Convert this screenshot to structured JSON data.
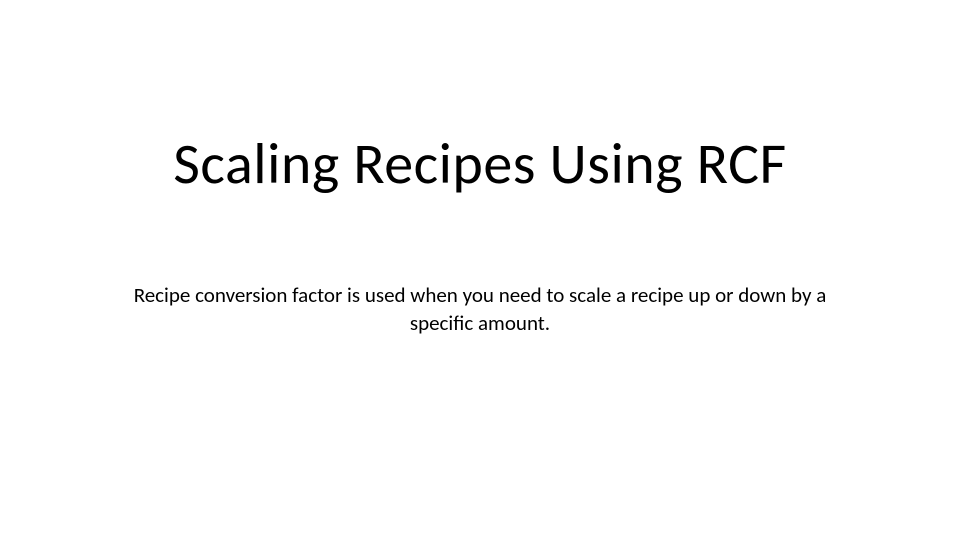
{
  "slide": {
    "title": "Scaling Recipes Using RCF",
    "body": "Recipe conversion factor is used when you need to scale a recipe up or down by a specific amount."
  }
}
